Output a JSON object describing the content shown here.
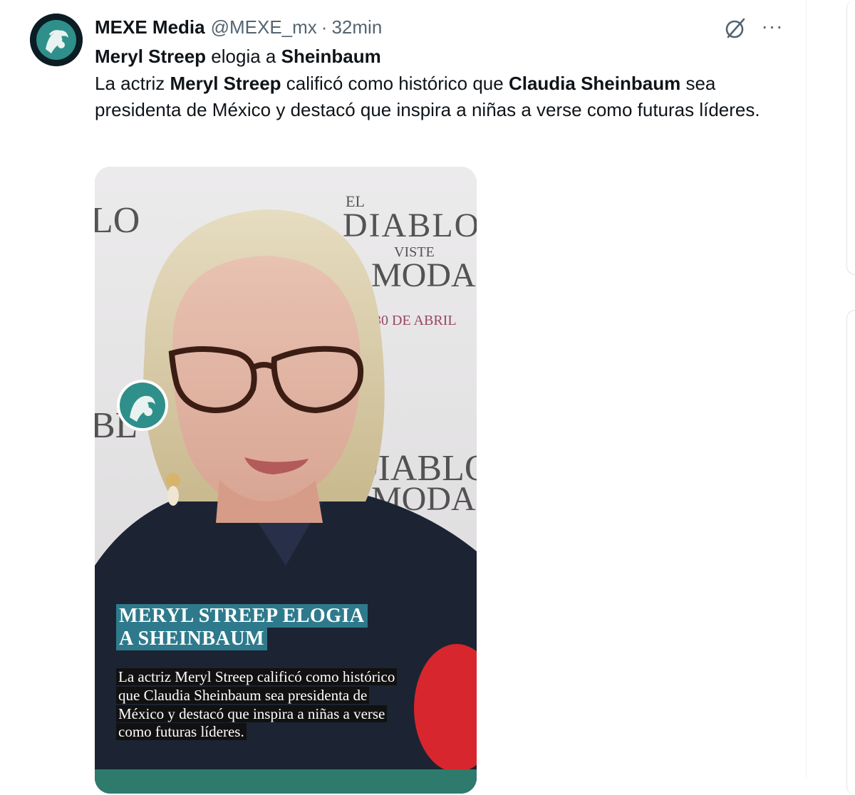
{
  "tweet": {
    "display_name": "MEXE Media",
    "handle": "@MEXE_mx",
    "separator": "·",
    "time": "32min",
    "more_label": "···",
    "text": {
      "headline_name": "Meryl Streep",
      "headline_verb": " elogia a ",
      "headline_target": "Sheinbaum",
      "body_1": "La actriz ",
      "body_name_1": "Meryl Streep",
      "body_2": " calificó como histórico que ",
      "body_name_2": "Claudia Sheinbaum",
      "body_3": " sea presidenta de México y destacó que inspira a niñas a verse como futuras líderes."
    }
  },
  "media": {
    "backdrop_words": [
      "EL",
      "DIABLO",
      "VISTE",
      "MODA",
      "30 DE ABRIL"
    ],
    "overlay_title": "MERYL STREEP ELOGIA A SHEINBAUM",
    "overlay_body": "La actriz Meryl Streep calificó como histórico que Claudia Sheinbaum sea presidenta de México y destacó que inspira a niñas a verse como futuras líderes."
  },
  "icons": {
    "grok": "grok-icon",
    "more": "more-icon",
    "avatar": "mexe-logo"
  },
  "colors": {
    "text": "#0f1419",
    "muted": "#536471",
    "overlay_title_bg": "#2e7a8c",
    "overlay_body_bg": "#111111",
    "logo_teal": "#2f8f8a"
  }
}
